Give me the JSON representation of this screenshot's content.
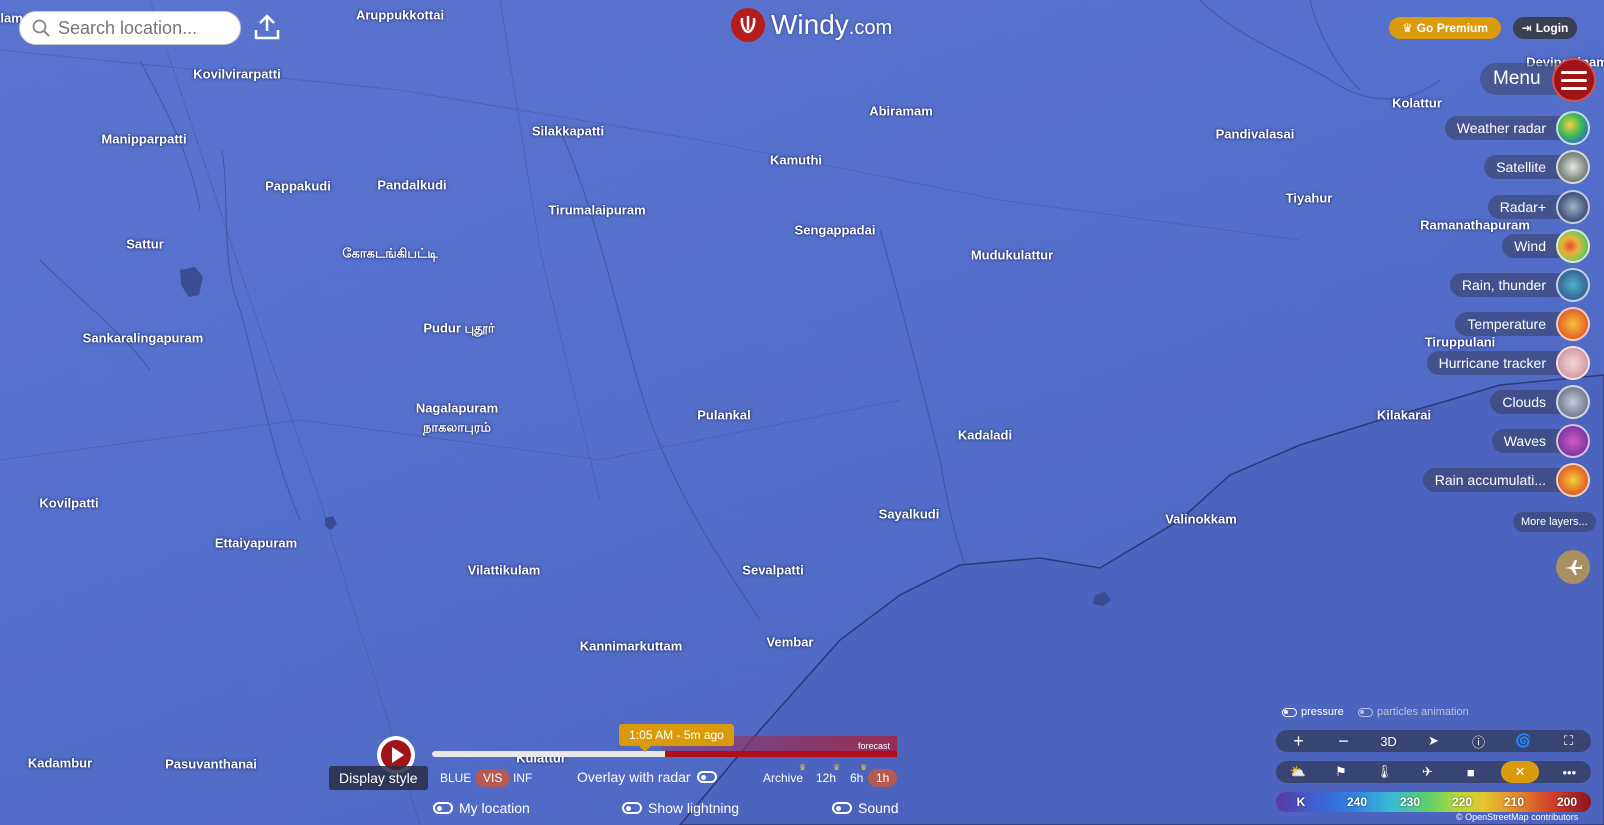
{
  "search": {
    "placeholder": "Search location..."
  },
  "brand": {
    "name": "Windy",
    "suffix": ".com"
  },
  "header": {
    "premium_label": "Go Premium",
    "login_label": "Login"
  },
  "menu": {
    "label": "Menu"
  },
  "places": [
    {
      "name": "Aruppukkottai"
    },
    {
      "name": "Kovilvirarpatti"
    },
    {
      "name": "Manipparpatti"
    },
    {
      "name": "Silakkapatti"
    },
    {
      "name": "Abiramam"
    },
    {
      "name": "Kamuthi"
    },
    {
      "name": "Pappakudi"
    },
    {
      "name": "Pandalkudi"
    },
    {
      "name": "Tirumalaipuram"
    },
    {
      "name": "Sengappadai"
    },
    {
      "name": "Mudukulattur"
    },
    {
      "name": "Sattur"
    },
    {
      "name": "கோகடங்கிபட்டி"
    },
    {
      "name": "Sankaralingapuram"
    },
    {
      "name": "Pudur புதூர்"
    },
    {
      "name": "Nagalapuram"
    },
    {
      "name": "நாகலாபுரம்"
    },
    {
      "name": "Pulankal"
    },
    {
      "name": "Kadaladi"
    },
    {
      "name": "Kovilpatti"
    },
    {
      "name": "Sayalkudi"
    },
    {
      "name": "Valinokkam"
    },
    {
      "name": "Ettaiyapuram"
    },
    {
      "name": "Vilattikulam"
    },
    {
      "name": "Sevalpatti"
    },
    {
      "name": "Kannimarkuttam"
    },
    {
      "name": "Vembar"
    },
    {
      "name": "Kadambur"
    },
    {
      "name": "Pasuvanthanai"
    },
    {
      "name": "Kulattur"
    },
    {
      "name": "Kolattur"
    },
    {
      "name": "Pandivalasai"
    },
    {
      "name": "Tiyahur"
    },
    {
      "name": "Ramanathapuram"
    },
    {
      "name": "Tiruppulani"
    },
    {
      "name": "Kilakarai"
    },
    {
      "name": "Devipattinam"
    },
    {
      "name": "alam"
    }
  ],
  "layers": [
    {
      "label": "Weather radar",
      "icon": "weather-radar-thumb"
    },
    {
      "label": "Satellite",
      "icon": "satellite-thumb"
    },
    {
      "label": "Radar+",
      "icon": "radar-plus-thumb"
    },
    {
      "label": "Wind",
      "icon": "wind-thumb"
    },
    {
      "label": "Rain, thunder",
      "icon": "rain-thunder-thumb"
    },
    {
      "label": "Temperature",
      "icon": "temperature-thumb"
    },
    {
      "label": "Hurricane tracker",
      "icon": "hurricane-thumb"
    },
    {
      "label": "Clouds",
      "icon": "clouds-thumb"
    },
    {
      "label": "Waves",
      "icon": "waves-thumb"
    },
    {
      "label": "Rain accumulati...",
      "icon": "rain-accumulation-thumb"
    }
  ],
  "more_layers_label": "More layers...",
  "overlay_toggles": {
    "pressure": "pressure",
    "particles": "particles animation"
  },
  "toolbar1": {
    "zoom_in": "+",
    "zoom_out": "−",
    "threed": "3D"
  },
  "legend": {
    "unit": "K",
    "ticks": [
      "240",
      "230",
      "220",
      "210",
      "200"
    ]
  },
  "copyright": "© OpenStreetMap contributors",
  "timeline": {
    "time_label": "1:05 AM - 5m ago",
    "forecast_label": "forecast",
    "progress": 0.5,
    "display_style_label": "Display style",
    "styles": [
      "BLUE",
      "VIS",
      "INF"
    ],
    "selected_style": "VIS",
    "overlay_radar_label": "Overlay with radar",
    "archive_label": "Archive",
    "intervals": [
      "12h",
      "6h",
      "1h"
    ],
    "selected_interval": "1h"
  },
  "bottom_toggles": {
    "my_location": "My location",
    "show_lightning": "Show lightning",
    "sound": "Sound"
  },
  "colors": {
    "accent": "#d99b0c",
    "brand_red": "#b71c1c",
    "map_bg": "#5570cc"
  }
}
